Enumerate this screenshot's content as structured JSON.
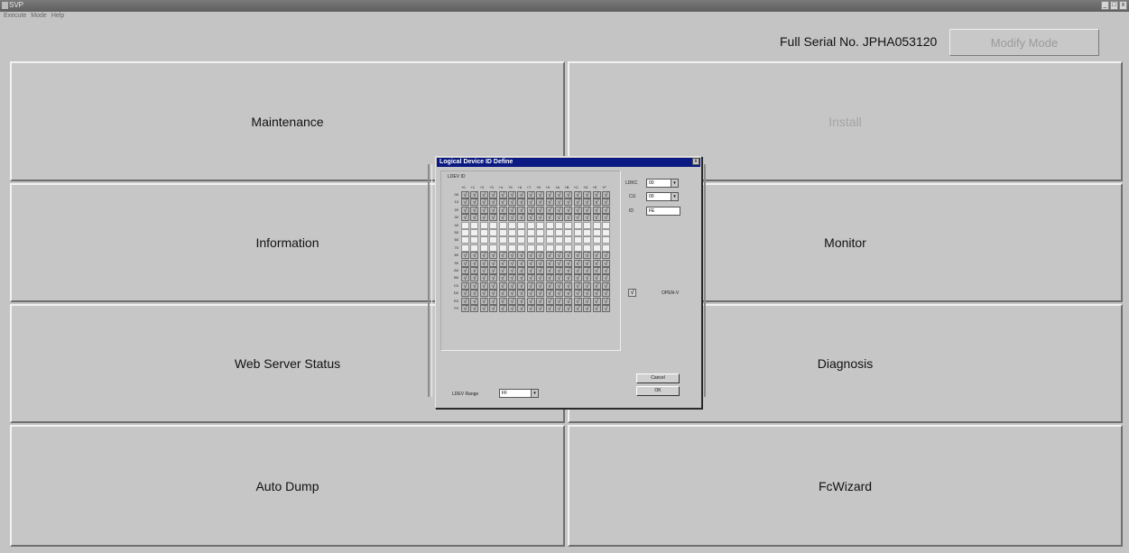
{
  "window": {
    "title": "SVP"
  },
  "menu": [
    "Execute",
    "Mode",
    "Help"
  ],
  "title_controls": [
    "_",
    "□",
    "x"
  ],
  "header": {
    "serial": "Full Serial No. JPHA053120",
    "modify_label": "Modify Mode"
  },
  "buttons": {
    "maintenance": "Maintenance",
    "install": "Install",
    "information": "Information",
    "monitor": "Monitor",
    "web_server_status": "Web Server Status",
    "diagnosis": "Diagnosis",
    "auto_dump": "Auto Dump",
    "fcwizard": "FcWizard"
  },
  "dialog": {
    "title": "Logical Device ID Define",
    "close": "x",
    "group_label": "LDEV ID",
    "col_headers": [
      "+0",
      "+1",
      "+2",
      "+3",
      "+4",
      "+5",
      "+6",
      "+7",
      "+8",
      "+9",
      "+A",
      "+B",
      "+C",
      "+D",
      "+E",
      "+F"
    ],
    "row_labels": [
      "00",
      "10",
      "20",
      "30",
      "40",
      "50",
      "60",
      "70",
      "80",
      "90",
      "A0",
      "B0",
      "C0",
      "D0",
      "E0",
      "F0"
    ],
    "row_states": [
      "on",
      "on",
      "on",
      "on",
      "off",
      "off",
      "off",
      "off",
      "on",
      "on",
      "on",
      "on",
      "on",
      "on",
      "on",
      "on"
    ],
    "ldkc_label": "LDKC",
    "ldkc_value": "00",
    "cu_label": "CU",
    "cu_value": "00",
    "id_label": "ID",
    "id_value": "FE",
    "open_label": "OPEN-V",
    "range_label": "LDEV Range",
    "range_value": "FF",
    "cancel_label": "Cancel",
    "ok_label": "OK",
    "dropdown_arrow": "▾",
    "check_mark": "√"
  }
}
